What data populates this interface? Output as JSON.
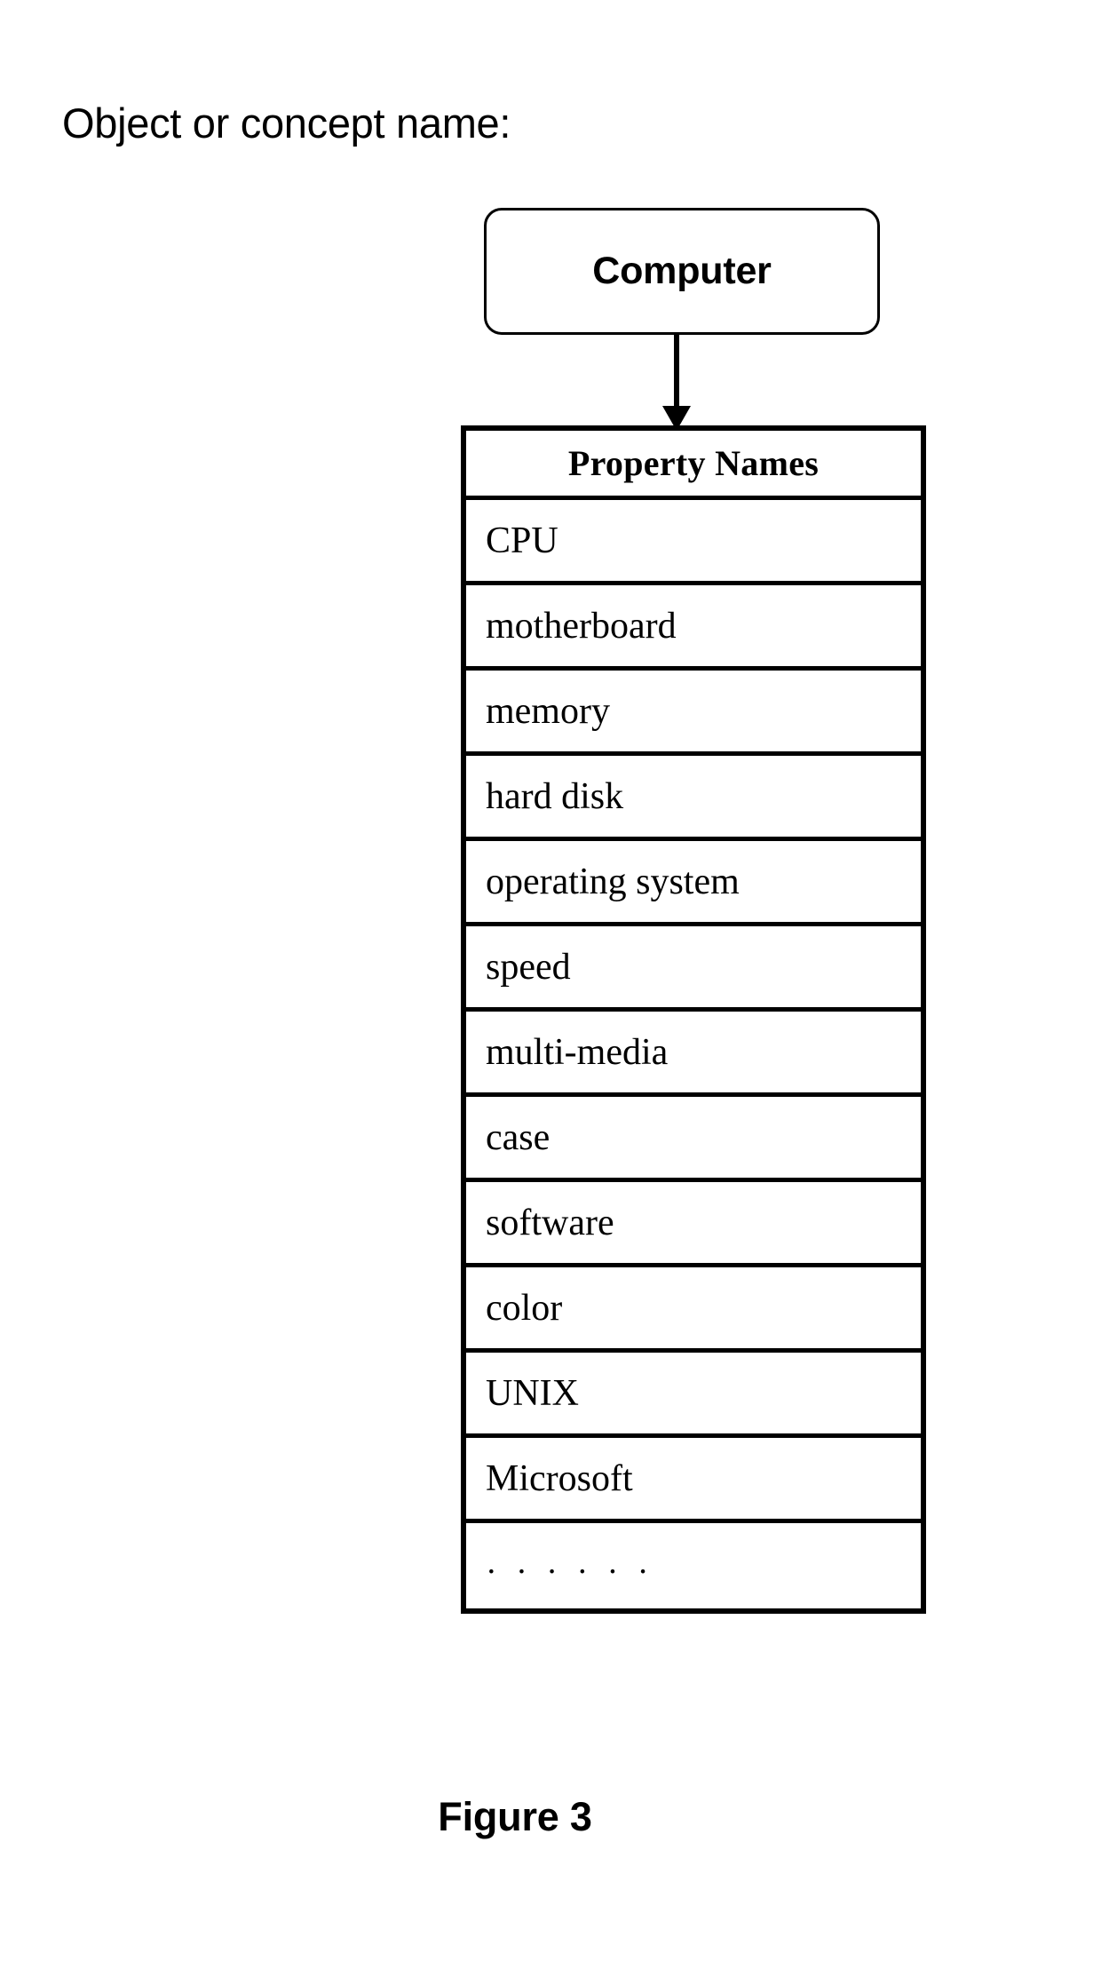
{
  "figure": {
    "title": "Object or concept name:",
    "caption": "Figure 3"
  },
  "root_node": {
    "label": "Computer",
    "shape": "rounded-rectangle",
    "border_color": "#000000",
    "fill_color": "#ffffff"
  },
  "connector": {
    "type": "arrow",
    "direction": "down",
    "from": "root_node",
    "to": "property_table",
    "color": "#000000"
  },
  "property_table": {
    "header": "Property Names",
    "rows": [
      {
        "label": "CPU"
      },
      {
        "label": "motherboard"
      },
      {
        "label": "memory"
      },
      {
        "label": "hard disk"
      },
      {
        "label": "operating system"
      },
      {
        "label": "speed"
      },
      {
        "label": "multi-media"
      },
      {
        "label": "case"
      },
      {
        "label": "software"
      },
      {
        "label": "color"
      },
      {
        "label": "UNIX"
      },
      {
        "label": "Microsoft"
      },
      {
        "label": "· · · · · ·"
      }
    ],
    "border_color": "#000000",
    "fill_color": "#ffffff"
  }
}
